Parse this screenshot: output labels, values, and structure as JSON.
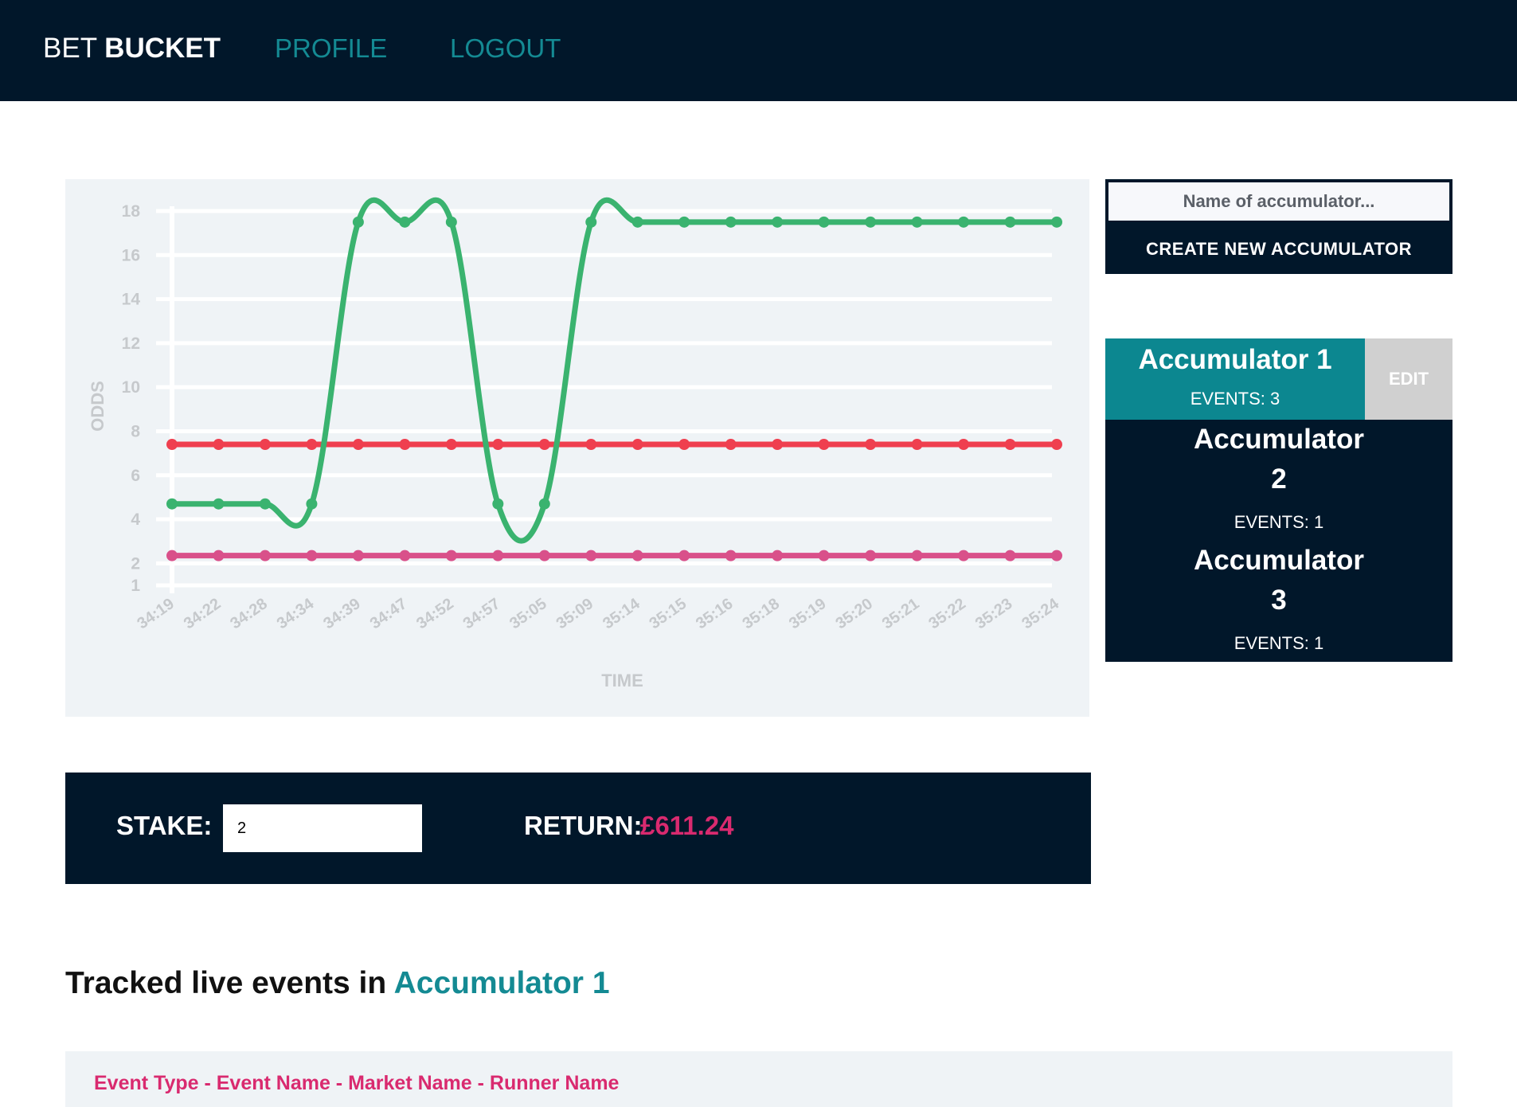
{
  "nav": {
    "brand_light": "BET",
    "brand_bold": "BUCKET",
    "profile": "PROFILE",
    "logout": "LOGOUT"
  },
  "create": {
    "placeholder": "Name of accumulator...",
    "button": "CREATE NEW ACCUMULATOR"
  },
  "accumulators": [
    {
      "name": "Accumulator 1",
      "events": "EVENTS: 3",
      "active": true
    },
    {
      "name_line1": "Accumulator",
      "name_line2": "2",
      "events": "EVENTS: 1"
    },
    {
      "name_line1": "Accumulator",
      "name_line2": "3",
      "events": "EVENTS: 1"
    }
  ],
  "edit_label": "EDIT",
  "stake": {
    "label": "STAKE:",
    "value": "2",
    "return_label": "RETURN:",
    "return_value": "£611.24"
  },
  "tracked": {
    "prefix": "Tracked live events in",
    "accumulator": "Accumulator 1"
  },
  "events_header": "Event Type - Event Name - Market Name - Runner Name",
  "colors": {
    "navy": "#01172a",
    "teal": "#148a93",
    "pink": "#d92a6f",
    "green": "#3ab36f",
    "red": "#ef3f4f",
    "magenta": "#d9508a"
  },
  "chart_data": {
    "type": "line",
    "xlabel": "TIME",
    "ylabel": "ODDS",
    "ylim": [
      1,
      18
    ],
    "yticks": [
      1,
      2,
      4,
      6,
      8,
      10,
      12,
      14,
      16,
      18
    ],
    "categories": [
      "34:19",
      "34:22",
      "34:28",
      "34:34",
      "34:39",
      "34:47",
      "34:52",
      "34:57",
      "35:05",
      "35:09",
      "35:14",
      "35:15",
      "35:16",
      "35:18",
      "35:19",
      "35:20",
      "35:21",
      "35:22",
      "35:23",
      "35:24"
    ],
    "series": [
      {
        "color": "#3ab36f",
        "values": [
          4.7,
          4.7,
          4.7,
          4.7,
          17.5,
          17.5,
          17.5,
          4.7,
          4.7,
          17.5,
          17.5,
          17.5,
          17.5,
          17.5,
          17.5,
          17.5,
          17.5,
          17.5,
          17.5,
          17.5
        ]
      },
      {
        "color": "#ef3f4f",
        "values": [
          7.4,
          7.4,
          7.4,
          7.4,
          7.4,
          7.4,
          7.4,
          7.4,
          7.4,
          7.4,
          7.4,
          7.4,
          7.4,
          7.4,
          7.4,
          7.4,
          7.4,
          7.4,
          7.4,
          7.4
        ]
      },
      {
        "color": "#d9508a",
        "values": [
          2.35,
          2.35,
          2.35,
          2.35,
          2.35,
          2.35,
          2.35,
          2.35,
          2.35,
          2.35,
          2.35,
          2.35,
          2.35,
          2.35,
          2.35,
          2.35,
          2.35,
          2.35,
          2.35,
          2.35
        ]
      }
    ],
    "grid": true
  }
}
